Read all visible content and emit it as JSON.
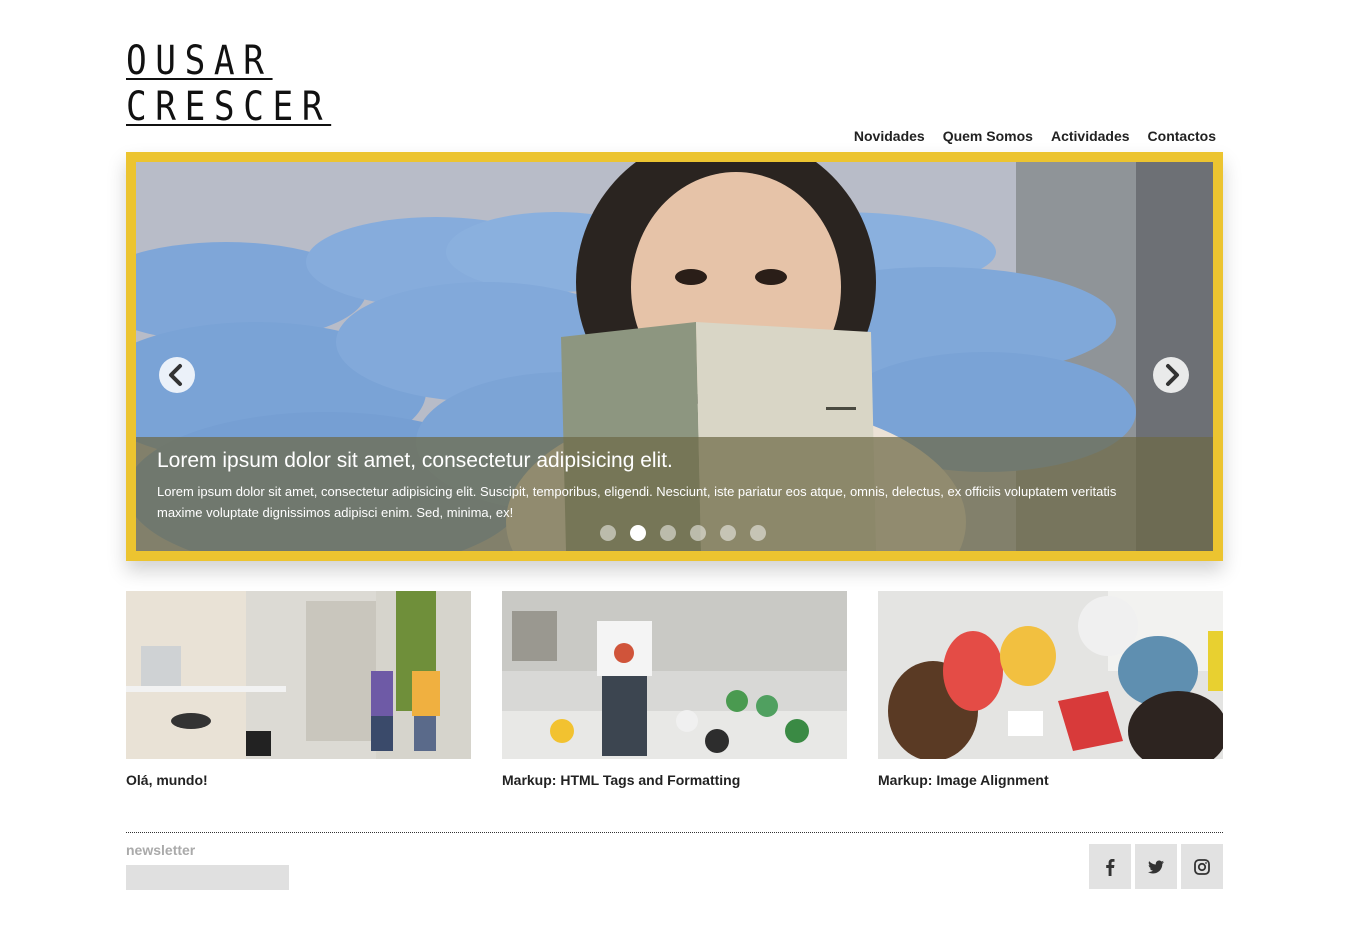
{
  "logo": {
    "line1": "OUSAR",
    "line2": "CRESCER"
  },
  "nav": [
    "Novidades",
    "Quem Somos",
    "Actividades",
    "Contactos"
  ],
  "slider": {
    "caption_title": "Lorem ipsum dolor sit amet, consectetur adipisicing elit.",
    "caption_text": "Lorem ipsum dolor sit amet, consectetur adipisicing elit. Suscipit, temporibus, eligendi. Nesciunt, iste pariatur eos atque, omnis, delectus, ex officiis voluptatem veritatis maxime voluptate dignissimos adipisci enim. Sed, minima, ex!",
    "dots_count": 6,
    "active_dot": 2
  },
  "posts": [
    {
      "title": "Olá, mundo!"
    },
    {
      "title": "Markup: HTML Tags and Formatting"
    },
    {
      "title": "Markup: Image Alignment"
    }
  ],
  "footer": {
    "newsletter_label": "newsletter",
    "social": [
      "facebook-icon",
      "twitter-icon",
      "instagram-icon"
    ]
  },
  "colors": {
    "accent": "#ecc430",
    "caption_bg": "#6e6946"
  }
}
